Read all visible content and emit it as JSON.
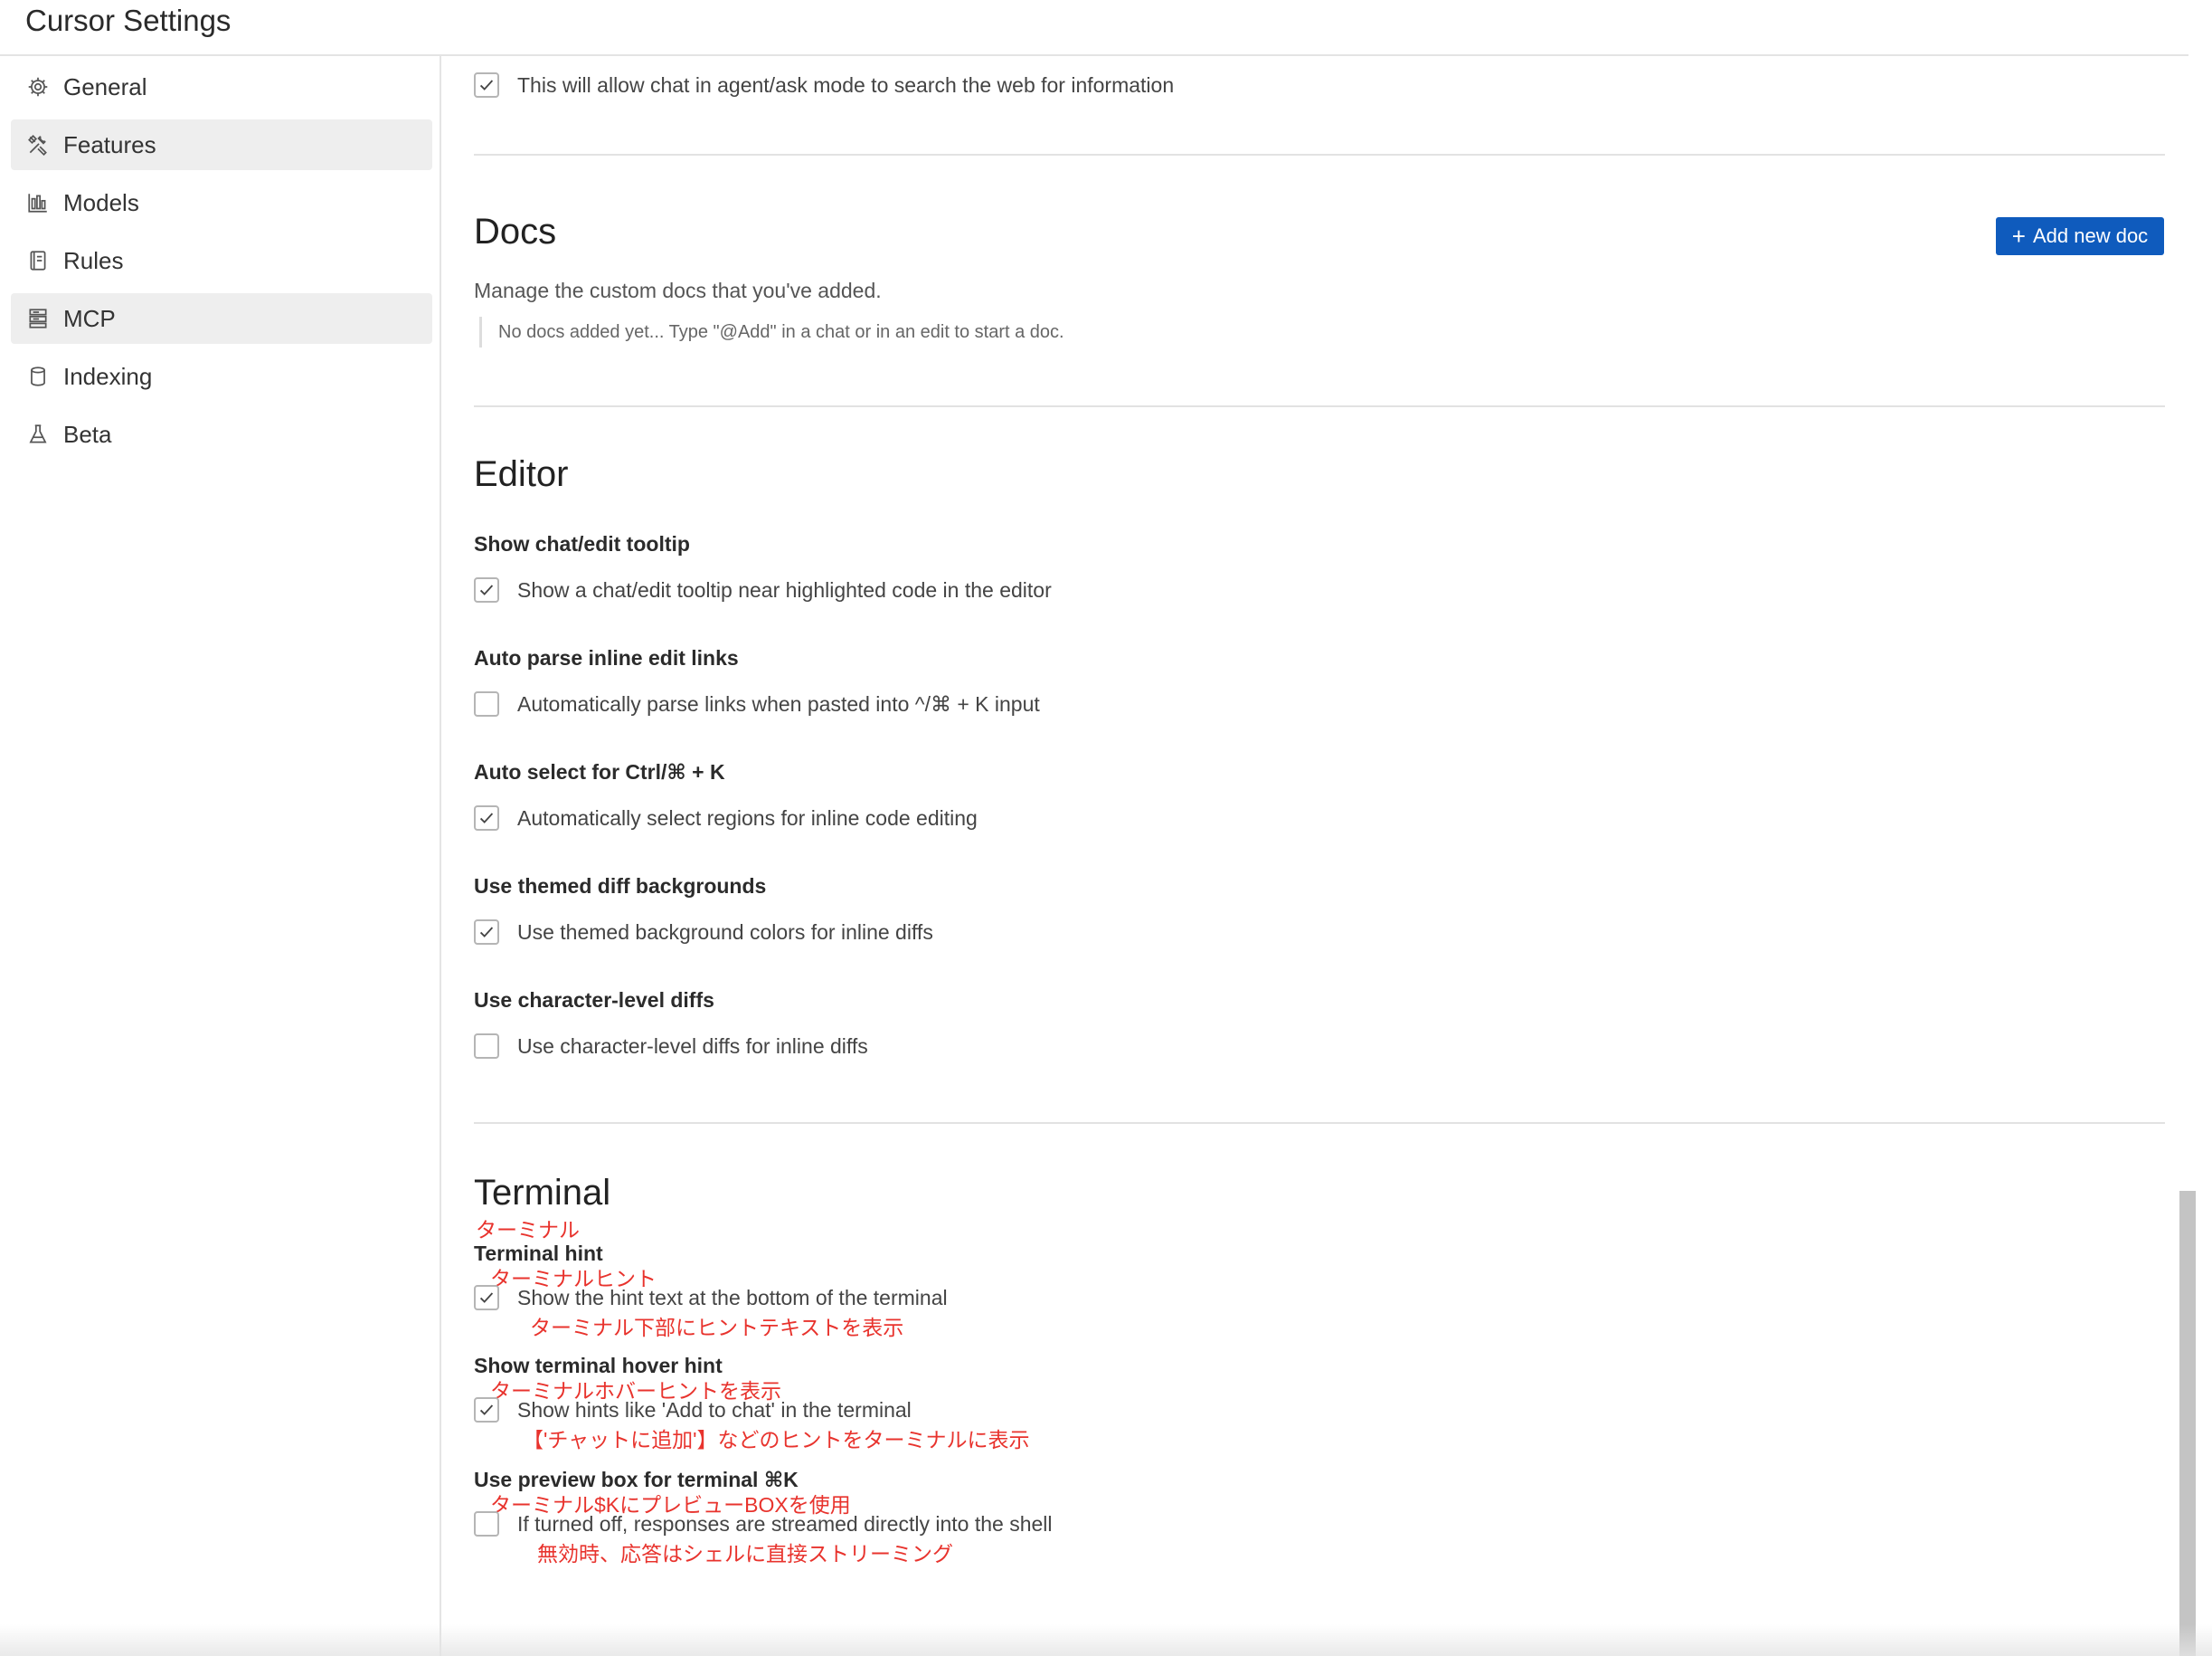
{
  "app": {
    "title": "Cursor Settings"
  },
  "sidebar": {
    "items": [
      {
        "label": "General",
        "icon": "gear-icon",
        "active": false
      },
      {
        "label": "Features",
        "icon": "tools-icon",
        "active": true
      },
      {
        "label": "Models",
        "icon": "bar-chart-icon",
        "active": false
      },
      {
        "label": "Rules",
        "icon": "document-icon",
        "active": false
      },
      {
        "label": "MCP",
        "icon": "server-icon",
        "active": true
      },
      {
        "label": "Indexing",
        "icon": "database-icon",
        "active": false
      },
      {
        "label": "Beta",
        "icon": "flask-icon",
        "active": false
      }
    ]
  },
  "web_search": {
    "text": "This will allow chat in agent/ask mode to search the web for information",
    "checked": true
  },
  "docs": {
    "title": "Docs",
    "description": "Manage the custom docs that you've added.",
    "empty_note": "No docs added yet... Type \"@Add\" in a chat or in an edit to start a doc.",
    "add_button": "Add new doc"
  },
  "editor": {
    "title": "Editor",
    "settings": [
      {
        "title": "Show chat/edit tooltip",
        "text": "Show a chat/edit tooltip near highlighted code in the editor",
        "checked": true
      },
      {
        "title": "Auto parse inline edit links",
        "text": "Automatically parse links when pasted into ^/⌘ + K input",
        "checked": false
      },
      {
        "title": "Auto select for Ctrl/⌘ + K",
        "text": "Automatically select regions for inline code editing",
        "checked": true
      },
      {
        "title": "Use themed diff backgrounds",
        "text": "Use themed background colors for inline diffs",
        "checked": true
      },
      {
        "title": "Use character-level diffs",
        "text": "Use character-level diffs for inline diffs",
        "checked": false
      }
    ]
  },
  "terminal": {
    "title": "Terminal",
    "title_jp": "ターミナル",
    "settings": [
      {
        "title": "Terminal hint",
        "title_jp": "ターミナルヒント",
        "text": "Show the hint text at the bottom of the terminal",
        "text_jp": "ターミナル下部にヒントテキストを表示",
        "checked": true
      },
      {
        "title": "Show terminal hover hint",
        "title_jp": "ターミナルホバーヒントを表示",
        "text": "Show hints like 'Add to chat' in the terminal",
        "text_jp": "【'チャットに追加'】などのヒントをターミナルに表示",
        "checked": true
      },
      {
        "title": "Use preview box for terminal ⌘K",
        "title_jp": "ターミナル$KにプレビューBOXを使用",
        "text": "If turned off, responses are streamed directly into the shell",
        "text_jp": "無効時、応答はシェルに直接ストリーミング",
        "checked": false
      }
    ]
  },
  "colors": {
    "accent": "#0f5bbd",
    "annotation": "#e8332d",
    "active_bg": "#eeeeee"
  }
}
